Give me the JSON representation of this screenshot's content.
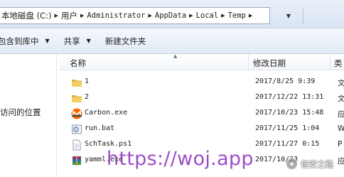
{
  "address_bar": {
    "crumbs": [
      "本地磁盘 (C:)",
      "用户",
      "Administrator",
      "AppData",
      "Local",
      "Temp"
    ]
  },
  "toolbar": {
    "include_label": "包含到库中",
    "share_label": "共享",
    "new_folder_label": "新建文件夹"
  },
  "nav": {
    "recent_label": "访问的位置"
  },
  "columns": {
    "name": "名称",
    "date_modified": "修改日期",
    "type_partial": "类"
  },
  "files": [
    {
      "name": "1",
      "date": "2017/8/25 9:39",
      "type": "文",
      "icon": "folder-icon"
    },
    {
      "name": "2",
      "date": "2017/12/22 13:31",
      "type": "文",
      "icon": "folder-icon"
    },
    {
      "name": "Carbon.exe",
      "date": "2017/10/23 15:48",
      "type": "应",
      "icon": "monero-icon"
    },
    {
      "name": "run.bat",
      "date": "2017/11/25 1:04",
      "type": "W",
      "icon": "batch-file-icon"
    },
    {
      "name": "SchTask.ps1",
      "date": "2017/11/27 0:15",
      "type": "P",
      "icon": "script-file-icon"
    },
    {
      "name": "yamml.exe",
      "date": "2017/10/23",
      "type": "应",
      "icon": "winrar-icon"
    }
  ],
  "watermark": {
    "url": "https://woj.app",
    "badge": "信安之路"
  },
  "colors": {
    "folder": "#f2c24a",
    "monero": "#ff6600",
    "watermark": "#8e2ebd"
  }
}
